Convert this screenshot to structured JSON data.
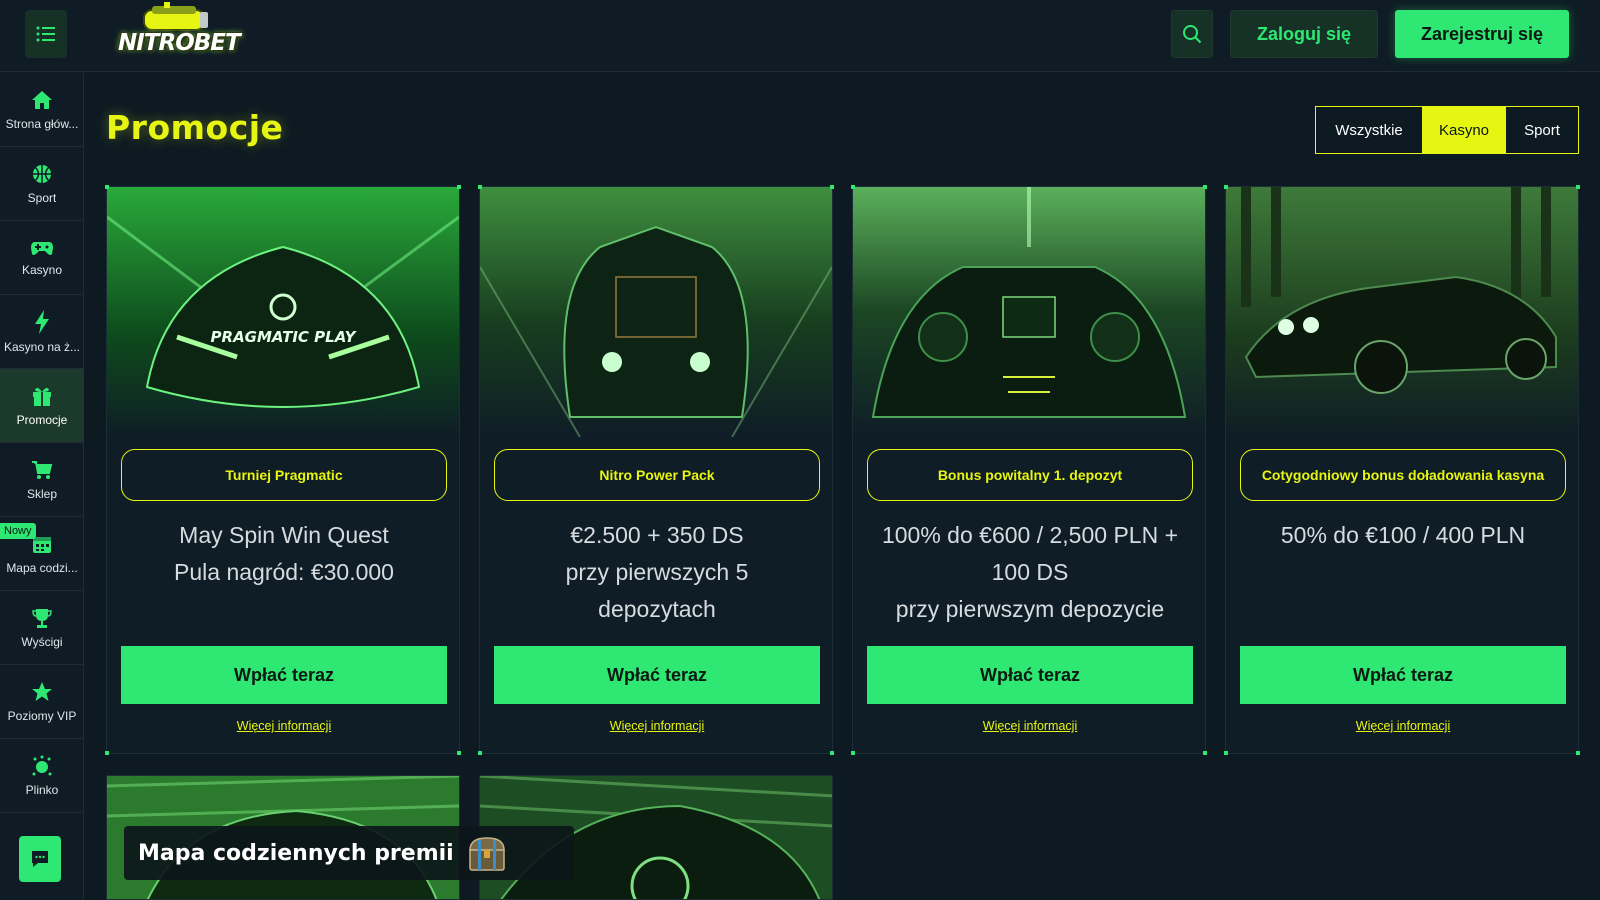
{
  "header": {
    "logo_text": "NITROBET",
    "login_label": "Zaloguj się",
    "register_label": "Zarejestruj się",
    "menu_icon": "menu-icon",
    "search_icon": "search-icon"
  },
  "sidebar": {
    "items": [
      {
        "label": "Strona głów...",
        "icon": "home-icon"
      },
      {
        "label": "Sport",
        "icon": "basketball-icon"
      },
      {
        "label": "Kasyno",
        "icon": "gamepad-icon"
      },
      {
        "label": "Kasyno na ż...",
        "icon": "lightning-icon"
      },
      {
        "label": "Promocje",
        "icon": "gift-icon"
      },
      {
        "label": "Sklep",
        "icon": "cart-icon"
      },
      {
        "label": "Mapa codzi...",
        "icon": "calendar-icon",
        "badge": "Nowy"
      },
      {
        "label": "Wyścigi",
        "icon": "trophy-icon"
      },
      {
        "label": "Poziomy VIP",
        "icon": "star-icon"
      },
      {
        "label": "Plinko",
        "icon": "plinko-icon"
      }
    ],
    "active_index": 4,
    "chat_icon": "chat-icon"
  },
  "main": {
    "title": "Promocje",
    "filters": [
      {
        "label": "Wszystkie",
        "active": false
      },
      {
        "label": "Kasyno",
        "active": true
      },
      {
        "label": "Sport",
        "active": false
      }
    ],
    "cards": [
      {
        "image_text": "PRAGMATIC PLAY",
        "title": "Turniej Pragmatic",
        "desc_lines": [
          "May Spin Win Quest",
          "Pula nagród: €30.000"
        ],
        "button": "Wpłać teraz",
        "more": "Więcej informacji"
      },
      {
        "title": "Nitro Power Pack",
        "desc_lines": [
          "€2.500 + 350 DS",
          "przy pierwszych 5",
          "depozytach"
        ],
        "button": "Wpłać teraz",
        "more": "Więcej informacji"
      },
      {
        "title": "Bonus powitalny 1. depozyt",
        "desc_lines": [
          "100% do €600 / 2,500 PLN +",
          "100 DS",
          "przy pierwszym depozycie"
        ],
        "button": "Wpłać teraz",
        "more": "Więcej informacji"
      },
      {
        "title": "Cotygodniowy bonus doładowania kasyna",
        "desc_lines": [
          "50% do €100 / 400 PLN"
        ],
        "button": "Wpłać teraz",
        "more": "Więcej informacji"
      }
    ],
    "daily_map_banner": "Mapa codziennych premii"
  },
  "colors": {
    "accent_green": "#2ee873",
    "accent_yellow": "#e7f513",
    "background": "#0d1a22"
  }
}
